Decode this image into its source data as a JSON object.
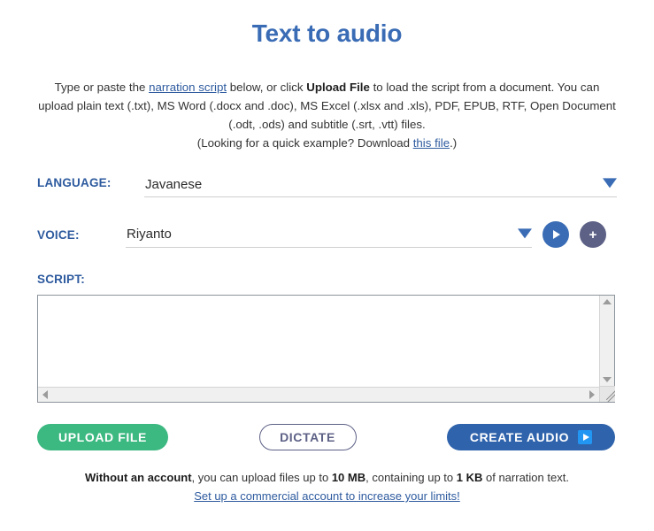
{
  "page": {
    "title": "Text to audio",
    "accent_blue": "#3a6cb5",
    "label_blue": "#2d5a9e",
    "green": "#3cb881",
    "purple_gray": "#5d6186"
  },
  "description": {
    "seg1": "Type or paste the ",
    "link_narration": "narration script",
    "seg2": " below, or click ",
    "bold_upload": "Upload File",
    "seg3": " to load the script from a document. You can upload plain text (.txt), MS Word (.docx and .doc), MS Excel (.xlsx and .xls), PDF, EPUB, RTF, Open Document (.odt, .ods) and subtitle (.srt, .vtt) files.",
    "example_prefix": "(Looking for a quick example? Download ",
    "example_link": "this file",
    "example_suffix": ".)"
  },
  "form": {
    "language": {
      "label": "LANGUAGE:",
      "value": "Javanese",
      "caret": "chevron-down-icon"
    },
    "voice": {
      "label": "VOICE:",
      "value": "Riyanto",
      "caret": "chevron-down-icon",
      "preview_icon": "play-icon",
      "add_icon": "plus-icon"
    },
    "script": {
      "label": "SCRIPT:",
      "value": "",
      "placeholder": ""
    }
  },
  "actions": {
    "upload": "UPLOAD FILE",
    "dictate": "DICTATE",
    "create": "CREATE AUDIO",
    "create_icon": "play-icon"
  },
  "footer": {
    "bold_lead": "Without an account",
    "mid1": ", you can upload files up to ",
    "bold_size": "10 MB",
    "mid2": ", containing up to ",
    "bold_text_limit": "1 KB",
    "mid3": " of narration text.",
    "link": "Set up a commercial account to increase your limits!"
  }
}
